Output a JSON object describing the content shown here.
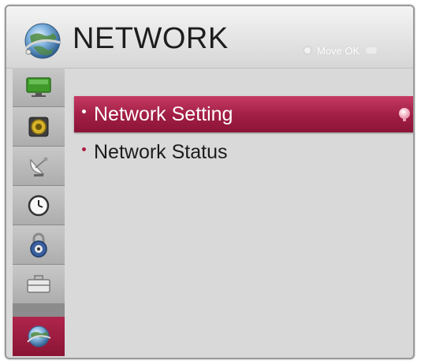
{
  "header": {
    "title": "NETWORK",
    "hint": "Move OK",
    "icon": "network-globe-icon"
  },
  "sidebar": {
    "items": [
      {
        "icon": "picture-monitor-icon",
        "active": false
      },
      {
        "icon": "audio-speaker-icon",
        "active": false
      },
      {
        "icon": "channel-satellite-icon",
        "active": false
      },
      {
        "icon": "time-clock-icon",
        "active": false
      },
      {
        "icon": "lock-icon",
        "active": false
      },
      {
        "icon": "option-toolbox-icon",
        "active": false
      },
      {
        "icon": "network-globe-icon",
        "active": true
      }
    ]
  },
  "menu": {
    "items": [
      {
        "label": "Network Setting",
        "selected": true
      },
      {
        "label": "Network Status",
        "selected": false
      }
    ]
  },
  "colors": {
    "accent": "#a01d44",
    "panel": "#d9d9d9",
    "sidebar": "#adadad"
  }
}
